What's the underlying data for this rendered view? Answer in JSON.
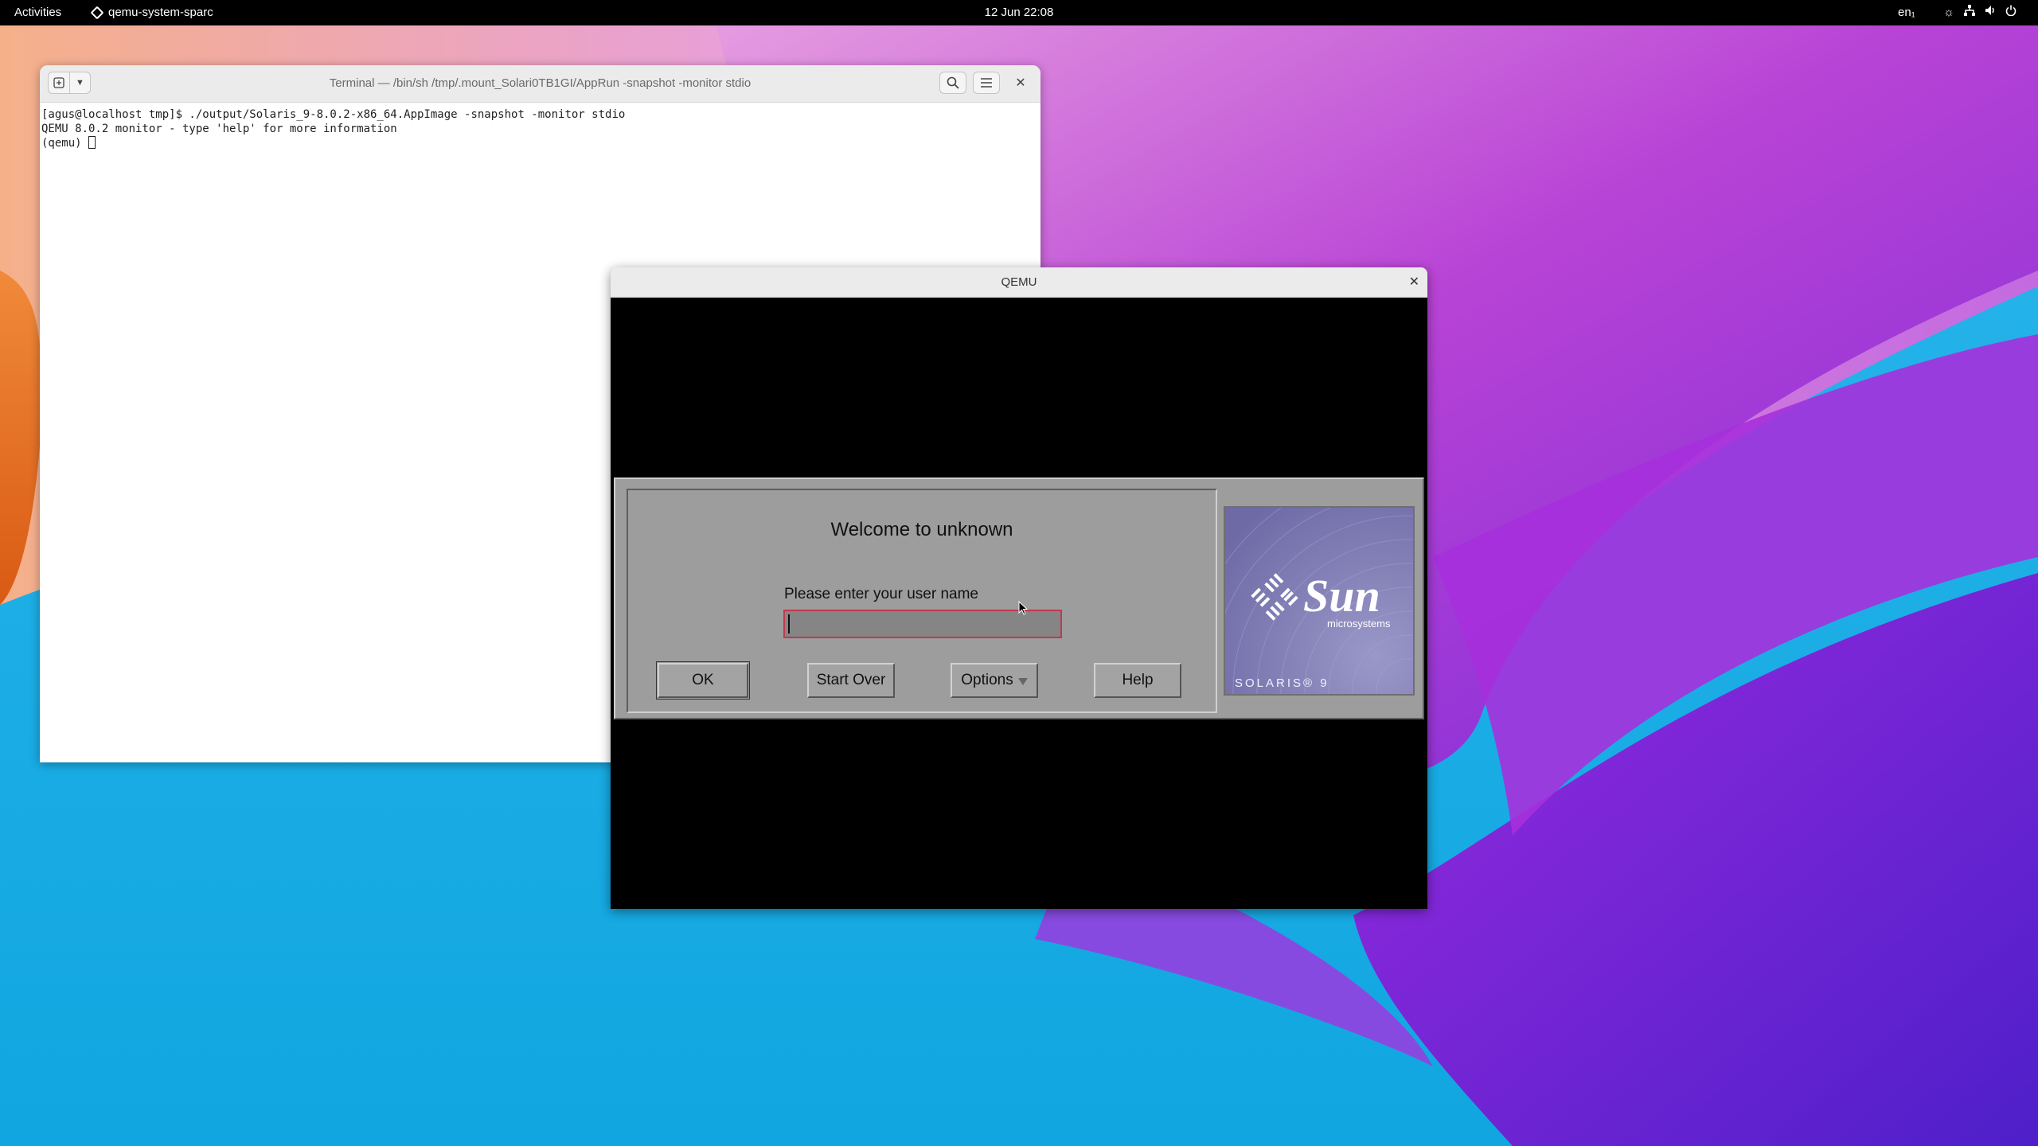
{
  "topbar": {
    "activities": "Activities",
    "app_name": "qemu-system-sparc",
    "clock": "12 Jun  22:08",
    "lang": "en₁",
    "tray_icons": [
      "brightness-icon",
      "network-icon",
      "volume-icon",
      "power-icon"
    ]
  },
  "terminal": {
    "title": "Terminal — /bin/sh /tmp/.mount_Solari0TB1GI/AppRun -snapshot -monitor stdio",
    "lines": [
      "[agus@localhost tmp]$ ./output/Solaris_9-8.0.2-x86_64.AppImage -snapshot -monitor stdio",
      "QEMU 8.0.2 monitor - type 'help' for more information",
      "(qemu) "
    ]
  },
  "qemu": {
    "title": "QEMU",
    "login": {
      "welcome": "Welcome to unknown",
      "prompt": "Please enter your user name",
      "username_value": "",
      "buttons": {
        "ok": "OK",
        "start_over": "Start Over",
        "options": "Options",
        "help": "Help"
      },
      "logo_text": "Sun",
      "logo_sub": "microsystems",
      "solaris_label": "SOLARIS® 9"
    }
  },
  "colors": {
    "topbar": "#000000",
    "cde_gray": "#9d9d9d",
    "input_border": "#c03a4e",
    "logo_bg": "#7a76b0"
  }
}
